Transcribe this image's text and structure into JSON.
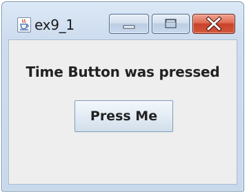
{
  "window": {
    "title": "ex9_1",
    "icon": "java-coffee-cup-icon"
  },
  "caption_buttons": {
    "minimize_icon": "minimize-icon",
    "maximize_icon": "maximize-icon",
    "close_icon": "close-icon",
    "close_color": "#c8412a"
  },
  "content": {
    "status_text": "Time Button was pressed",
    "button_label": "Press Me"
  }
}
